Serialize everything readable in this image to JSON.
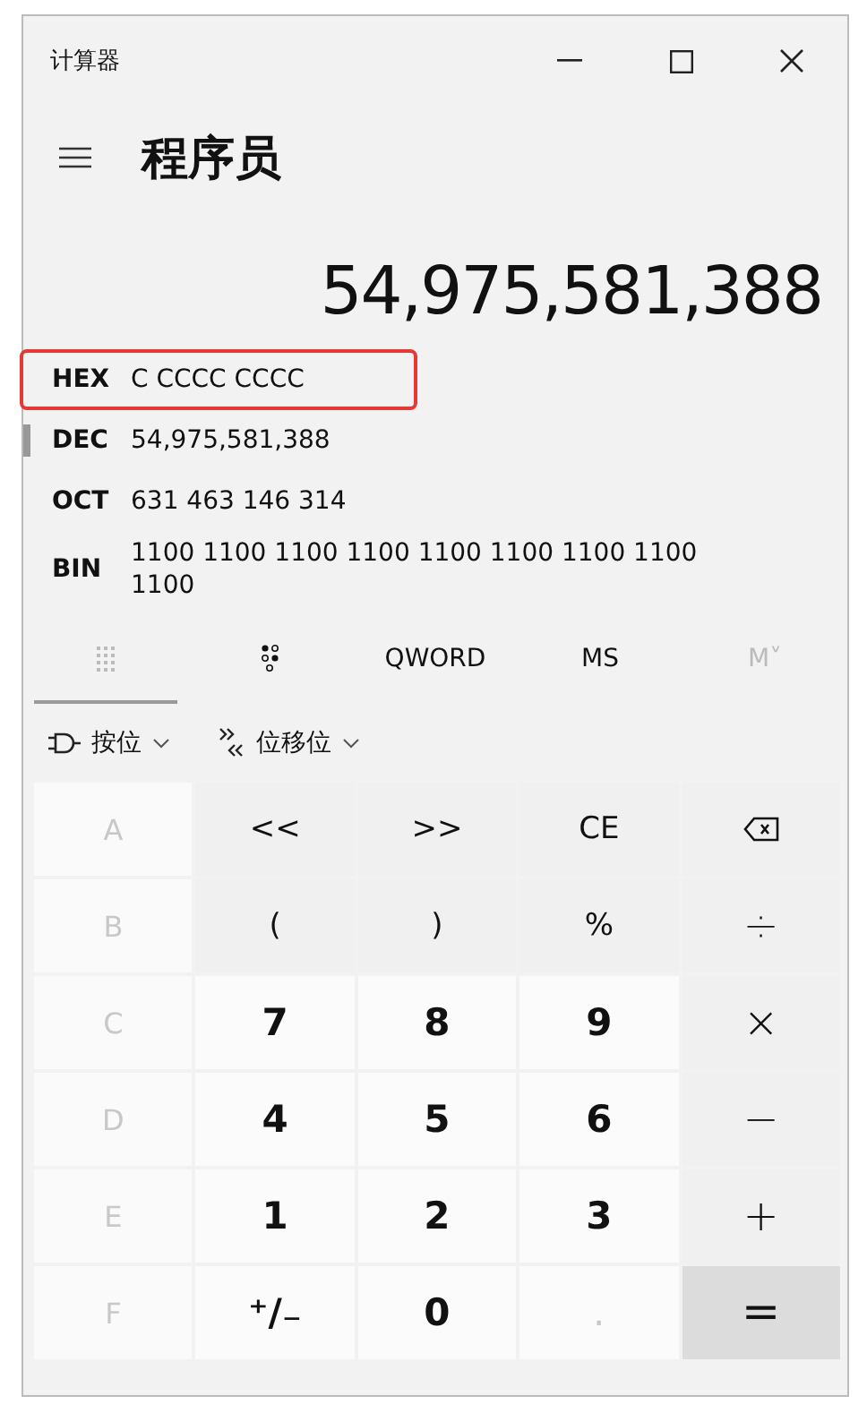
{
  "window": {
    "title": "计算器"
  },
  "header": {
    "mode": "程序员"
  },
  "display": {
    "value": "54,975,581,388"
  },
  "radix_rows": [
    {
      "label": "HEX",
      "value": "C CCCC CCCC",
      "selected": false,
      "highlighted": true
    },
    {
      "label": "DEC",
      "value": "54,975,581,388",
      "selected": true,
      "highlighted": false
    },
    {
      "label": "OCT",
      "value": "631 463 146 314",
      "selected": false,
      "highlighted": false
    },
    {
      "label": "BIN",
      "value": "1100 1100 1100 1100 1100 1100 1100 1100 1100",
      "selected": false,
      "highlighted": false
    }
  ],
  "tabs": [
    {
      "kind": "keypad",
      "selected": true,
      "disabled": false
    },
    {
      "kind": "bits",
      "selected": false,
      "disabled": false
    },
    {
      "kind": "text",
      "label": "QWORD",
      "selected": false,
      "disabled": false
    },
    {
      "kind": "text",
      "label": "MS",
      "selected": false,
      "disabled": false
    },
    {
      "kind": "text",
      "label": "M˅",
      "selected": false,
      "disabled": true
    }
  ],
  "toolbar": [
    {
      "kind": "bitwise",
      "label": "按位"
    },
    {
      "kind": "shift",
      "label": "位移位"
    }
  ],
  "keys": [
    {
      "label": "A",
      "kind": "hex",
      "disabled": true
    },
    {
      "label": "<<",
      "kind": "func",
      "disabled": false
    },
    {
      "label": ">>",
      "kind": "func",
      "disabled": false
    },
    {
      "label": "CE",
      "kind": "func",
      "disabled": false
    },
    {
      "kind": "backspace",
      "disabled": false
    },
    {
      "label": "B",
      "kind": "hex",
      "disabled": true
    },
    {
      "label": "(",
      "kind": "func",
      "disabled": false
    },
    {
      "label": ")",
      "kind": "func",
      "disabled": false
    },
    {
      "label": "%",
      "kind": "func",
      "disabled": false
    },
    {
      "label": "÷",
      "kind": "op",
      "disabled": false
    },
    {
      "label": "C",
      "kind": "hex",
      "disabled": true
    },
    {
      "label": "7",
      "kind": "digit",
      "disabled": false
    },
    {
      "label": "8",
      "kind": "digit",
      "disabled": false
    },
    {
      "label": "9",
      "kind": "digit",
      "disabled": false
    },
    {
      "label": "×",
      "kind": "op",
      "disabled": false
    },
    {
      "label": "D",
      "kind": "hex",
      "disabled": true
    },
    {
      "label": "4",
      "kind": "digit",
      "disabled": false
    },
    {
      "label": "5",
      "kind": "digit",
      "disabled": false
    },
    {
      "label": "6",
      "kind": "digit",
      "disabled": false
    },
    {
      "label": "−",
      "kind": "op",
      "disabled": false
    },
    {
      "label": "E",
      "kind": "hex",
      "disabled": true
    },
    {
      "label": "1",
      "kind": "digit",
      "disabled": false
    },
    {
      "label": "2",
      "kind": "digit",
      "disabled": false
    },
    {
      "label": "3",
      "kind": "digit",
      "disabled": false
    },
    {
      "label": "+",
      "kind": "op",
      "disabled": false
    },
    {
      "label": "F",
      "kind": "hex",
      "disabled": true
    },
    {
      "label": "⁺∕₋",
      "kind": "digit",
      "disabled": false
    },
    {
      "label": "0",
      "kind": "digit",
      "disabled": false
    },
    {
      "label": ".",
      "kind": "digit",
      "disabled": true
    },
    {
      "label": "=",
      "kind": "equals",
      "disabled": false
    }
  ]
}
